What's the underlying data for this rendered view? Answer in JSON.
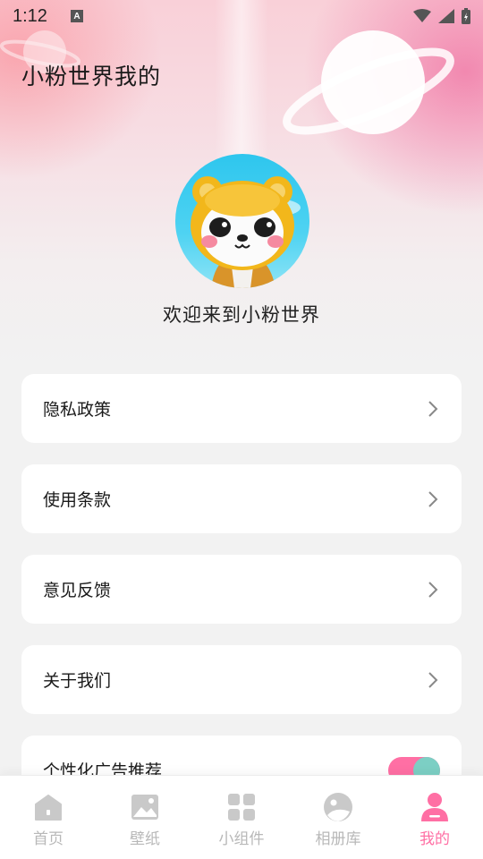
{
  "status_bar": {
    "time": "1:12",
    "notification_icon": "A"
  },
  "header": {
    "title": "小粉世界我的"
  },
  "profile": {
    "welcome_text": "欢迎来到小粉世界"
  },
  "menu": {
    "items": [
      {
        "label": "隐私政策"
      },
      {
        "label": "使用条款"
      },
      {
        "label": "意见反馈"
      },
      {
        "label": "关于我们"
      },
      {
        "label": "个性化广告推荐"
      }
    ],
    "ad_toggle_on": true
  },
  "tabbar": {
    "tabs": [
      {
        "label": "首页",
        "icon": "home-icon"
      },
      {
        "label": "壁纸",
        "icon": "image-icon"
      },
      {
        "label": "小组件",
        "icon": "widgets-icon"
      },
      {
        "label": "相册库",
        "icon": "album-icon"
      },
      {
        "label": "我的",
        "icon": "person-icon"
      }
    ],
    "active_index": 4
  },
  "colors": {
    "accent": "#ff6fa4",
    "tab_inactive": "#b8b8b8",
    "card_bg": "#ffffff"
  }
}
